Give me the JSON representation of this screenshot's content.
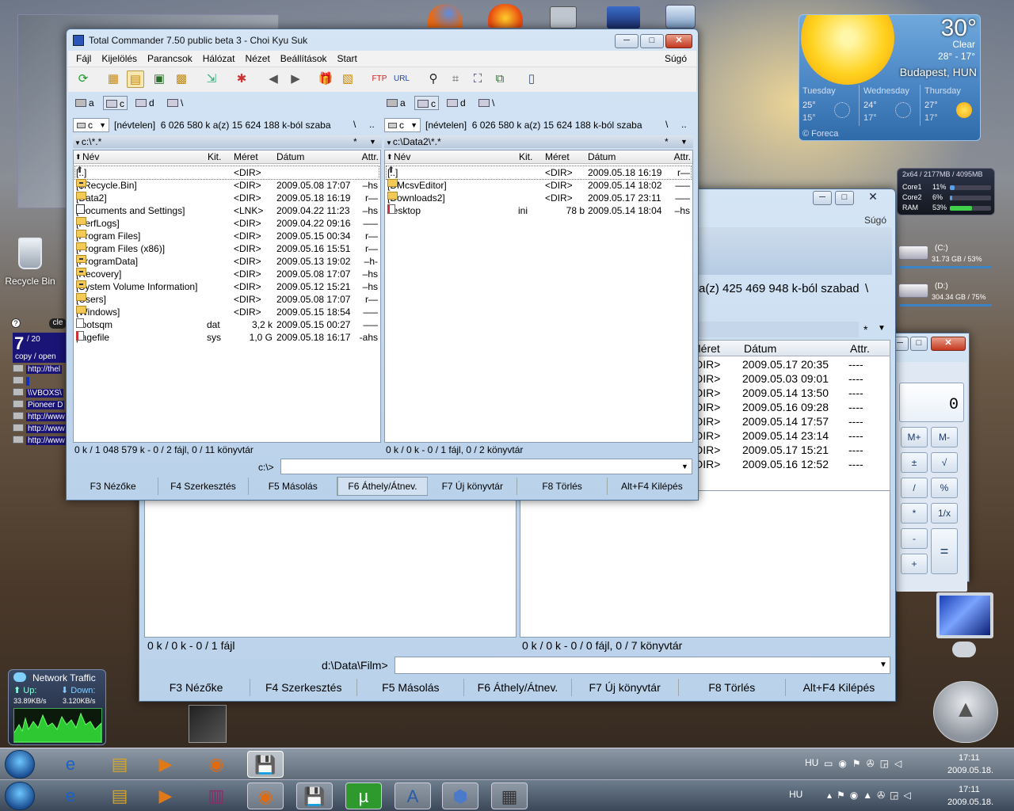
{
  "desktop": {
    "recycle_bin_label": "Recycle Bin",
    "gadget_counter": {
      "value": "7",
      "total": "/ 20",
      "caption": "copy / open",
      "btn_clear": "cle"
    },
    "url_items": [
      "http://thel",
      "",
      "\\\\VBOXS\\",
      "Pioneer D",
      "http://www",
      "http://www",
      "http://www"
    ]
  },
  "weather": {
    "temp": "30°",
    "condition": "Clear",
    "range": "28° - 17°",
    "location": "Budapest, HUN",
    "days": [
      {
        "name": "Tuesday",
        "hi": "25°",
        "lo": "15°"
      },
      {
        "name": "Wednesday",
        "hi": "24°",
        "lo": "17°"
      },
      {
        "name": "Thursday",
        "hi": "27°",
        "lo": "17°"
      }
    ],
    "provider": "© Foreca"
  },
  "cpu_gadget": {
    "header": "2x64 / 2177MB / 4095MB",
    "rows": [
      {
        "label": "Core1",
        "value": "11%",
        "fill": 0.11
      },
      {
        "label": "Core2",
        "value": "6%",
        "fill": 0.06
      },
      {
        "label": "RAM",
        "value": "53%",
        "fill": 0.53
      }
    ]
  },
  "drives_gadget": [
    {
      "name": "(C:)",
      "info": "31.73 GB / 53%"
    },
    {
      "name": "(D:)",
      "info": "304.34 GB / 75%"
    }
  ],
  "network": {
    "title": "Network Traffic",
    "up_label": "Up:",
    "down_label": "Down:",
    "up_value": "33.89KB/s",
    "down_value": "3.120KB/s"
  },
  "tc_main": {
    "title": "Total Commander 7.50 public beta 3 - Choi Kyu Suk",
    "menu": [
      "Fájl",
      "Kijelölés",
      "Parancsok",
      "Hálózat",
      "Nézet",
      "Beállítások",
      "Start"
    ],
    "help": "Súgó",
    "drives": [
      "a",
      "c",
      "d",
      "\\"
    ],
    "left": {
      "drive": "c",
      "info": "[névtelen]  6 026 580 k a(z) 15 624 188 k-ból szaba",
      "path": "c:\\*.*",
      "filter": "*",
      "headers": {
        "name": "Név",
        "ext": "Kit.",
        "size": "Méret",
        "date": "Dátum",
        "attr": "Attr."
      },
      "files": [
        {
          "name": "[..]",
          "ext": "",
          "size": "<DIR>",
          "date": "",
          "attr": "",
          "icon": "up"
        },
        {
          "name": "[$Recycle.Bin]",
          "ext": "",
          "size": "<DIR>",
          "date": "2009.05.08 17:07",
          "attr": "–hs",
          "icon": "lock"
        },
        {
          "name": "[Data2]",
          "ext": "",
          "size": "<DIR>",
          "date": "2009.05.18 16:19",
          "attr": "r—",
          "icon": "folder"
        },
        {
          "name": "[Documents and Settings]",
          "ext": "",
          "size": "<LNK>",
          "date": "2009.04.22 11:23",
          "attr": "–hs",
          "icon": "link"
        },
        {
          "name": "[PerfLogs]",
          "ext": "",
          "size": "<DIR>",
          "date": "2009.04.22 09:16",
          "attr": "—–",
          "icon": "folder"
        },
        {
          "name": "[Program Files]",
          "ext": "",
          "size": "<DIR>",
          "date": "2009.05.15 00:34",
          "attr": "r—",
          "icon": "folder"
        },
        {
          "name": "[Program Files (x86)]",
          "ext": "",
          "size": "<DIR>",
          "date": "2009.05.16 15:51",
          "attr": "r—",
          "icon": "folder"
        },
        {
          "name": "[ProgramData]",
          "ext": "",
          "size": "<DIR>",
          "date": "2009.05.13 19:02",
          "attr": "–h-",
          "icon": "lock"
        },
        {
          "name": "[Recovery]",
          "ext": "",
          "size": "<DIR>",
          "date": "2009.05.08 17:07",
          "attr": "–hs",
          "icon": "lock"
        },
        {
          "name": "[System Volume Information]",
          "ext": "",
          "size": "<DIR>",
          "date": "2009.05.12 15:21",
          "attr": "–hs",
          "icon": "lock"
        },
        {
          "name": "[Users]",
          "ext": "",
          "size": "<DIR>",
          "date": "2009.05.08 17:07",
          "attr": "r—",
          "icon": "folder"
        },
        {
          "name": "[Windows]",
          "ext": "",
          "size": "<DIR>",
          "date": "2009.05.15 18:54",
          "attr": "—–",
          "icon": "folder"
        },
        {
          "name": "bootsqm",
          "ext": "dat",
          "size": "3,2 k",
          "date": "2009.05.15 00:27",
          "attr": "—–",
          "icon": "file"
        },
        {
          "name": "pagefile",
          "ext": "sys",
          "size": "1,0 G",
          "date": "2009.05.18 16:17",
          "attr": "-ahs",
          "icon": "sysfile"
        }
      ],
      "status": "0 k / 1 048 579 k - 0 / 2 fájl, 0 / 11 könyvtár"
    },
    "right": {
      "drive": "c",
      "info": "[névtelen]  6 026 580 k a(z) 15 624 188 k-ból szaba",
      "path": "c:\\Data2\\*.*",
      "filter": "*",
      "headers": {
        "name": "Név",
        "ext": "Kit.",
        "size": "Méret",
        "date": "Dátum",
        "attr": "Attr."
      },
      "files": [
        {
          "name": "[..]",
          "ext": "",
          "size": "<DIR>",
          "date": "2009.05.18 16:19",
          "attr": "r—",
          "icon": "up"
        },
        {
          "name": "[DMcsvEditor]",
          "ext": "",
          "size": "<DIR>",
          "date": "2009.05.14 18:02",
          "attr": "—–",
          "icon": "folder"
        },
        {
          "name": "[Downloads2]",
          "ext": "",
          "size": "<DIR>",
          "date": "2009.05.17 23:11",
          "attr": "—–",
          "icon": "folder"
        },
        {
          "name": "desktop",
          "ext": "ini",
          "size": "78 b",
          "date": "2009.05.14 18:04",
          "attr": "–hs",
          "icon": "sysfile"
        }
      ],
      "status": "0 k / 0 k - 0 / 1 fájl, 0 / 2 könyvtár"
    },
    "cmd_label": "c:\\>",
    "fkeys": [
      "F3 Nézőke",
      "F4 Szerkesztés",
      "F5 Másolás",
      "F6 Áthely/Átnev.",
      "F7 Új könyvtár",
      "F8 Törlés",
      "Alt+F4 Kilépés"
    ]
  },
  "tc_back": {
    "help": "Súgó",
    "info_fragment": "a(z) 425 469 948 k-ból szabad",
    "headers": {
      "size": "Méret",
      "date": "Dátum",
      "attr": "Attr."
    },
    "filter": "*",
    "rows": [
      {
        "size": "<DIR>",
        "date": "2009.05.17 20:35",
        "attr": "----"
      },
      {
        "size": "<DIR>",
        "date": "2009.05.03 09:01",
        "attr": "----"
      },
      {
        "size": "<DIR>",
        "date": "2009.05.14 13:50",
        "attr": "----"
      },
      {
        "size": "<DIR>",
        "date": "2009.05.16 09:28",
        "attr": "----"
      },
      {
        "size": "<DIR>",
        "date": "2009.05.14 17:57",
        "attr": "----"
      },
      {
        "size": "<DIR>",
        "date": "2009.05.14 23:14",
        "attr": "----"
      },
      {
        "size": "<DIR>",
        "date": "2009.05.17 15:21",
        "attr": "----"
      },
      {
        "size": "<DIR>",
        "date": "2009.05.16 12:52",
        "attr": "----"
      }
    ],
    "status_left": "0 k / 0 k - 0 / 1 fájl",
    "status_right": "0 k / 0 k - 0 / 0 fájl, 0 / 7 könyvtár",
    "cmd_label": "d:\\Data\\Film>",
    "fkeys": [
      "F3 Nézőke",
      "F4 Szerkesztés",
      "F5 Másolás",
      "F6 Áthely/Átnev.",
      "F7 Új könyvtár",
      "F8 Törlés",
      "Alt+F4 Kilépés"
    ]
  },
  "calculator": {
    "display": "0",
    "buttons": [
      "M+",
      "M-",
      "±",
      "√",
      "/",
      "%",
      "*",
      "1/x",
      "-",
      "+",
      "="
    ]
  },
  "taskbar": {
    "lang": "HU",
    "time": "17:11",
    "date": "2009.05.18."
  }
}
